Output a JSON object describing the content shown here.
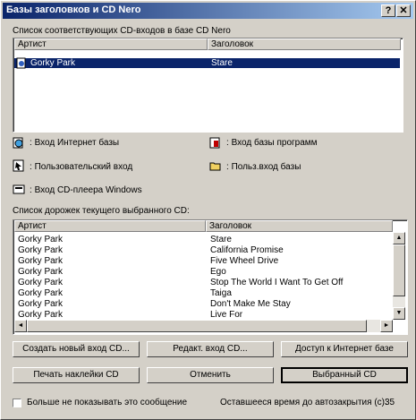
{
  "window": {
    "title": "Базы заголовков и CD Nero",
    "help_label": "?",
    "close_label": "✕"
  },
  "top_list": {
    "label": "Cписок соответствующих CD-входов в базе CD Nero",
    "columns": [
      "Артист",
      "Заголовок"
    ],
    "rows": [
      {
        "artist": "Gorky Park",
        "title": "Stare",
        "selected": true
      }
    ]
  },
  "legend": {
    "internet": "Вход Интернет базы",
    "program": "Вход базы программ",
    "user": "Пользовательский вход",
    "user_base": "Польз.вход базы",
    "cdplayer": "Вход CD-плеера Windows"
  },
  "track_list": {
    "label": "Список дорожек текущего выбранного CD:",
    "columns": [
      "Артист",
      "Заголовок"
    ],
    "rows": [
      {
        "artist": "Gorky Park",
        "title": "Stare"
      },
      {
        "artist": "Gorky Park",
        "title": "California Promise"
      },
      {
        "artist": "Gorky Park",
        "title": "Five Wheel Drive"
      },
      {
        "artist": "Gorky Park",
        "title": "Ego"
      },
      {
        "artist": "Gorky Park",
        "title": "Stop The World I Want To Get Off"
      },
      {
        "artist": "Gorky Park",
        "title": "Taiga"
      },
      {
        "artist": "Gorky Park",
        "title": "Don't Make Me Stay"
      },
      {
        "artist": "Gorky Park",
        "title": "Live For"
      }
    ]
  },
  "buttons": {
    "create": "Создать новый вход CD...",
    "edit": "Редакт. вход CD...",
    "internet": "Доступ к Интернет базе",
    "print": "Печать наклейки CD",
    "cancel": "Отменить",
    "selected": "Выбранный CD"
  },
  "footer": {
    "dont_show": "Больше не показывать это сообщение",
    "autoclose_label": "Оставшееся время до автозакрытия (с):",
    "autoclose_value": "35"
  },
  "colors": {
    "title_start": "#0a246a",
    "title_end": "#a6caf0",
    "selection": "#0a246a"
  }
}
